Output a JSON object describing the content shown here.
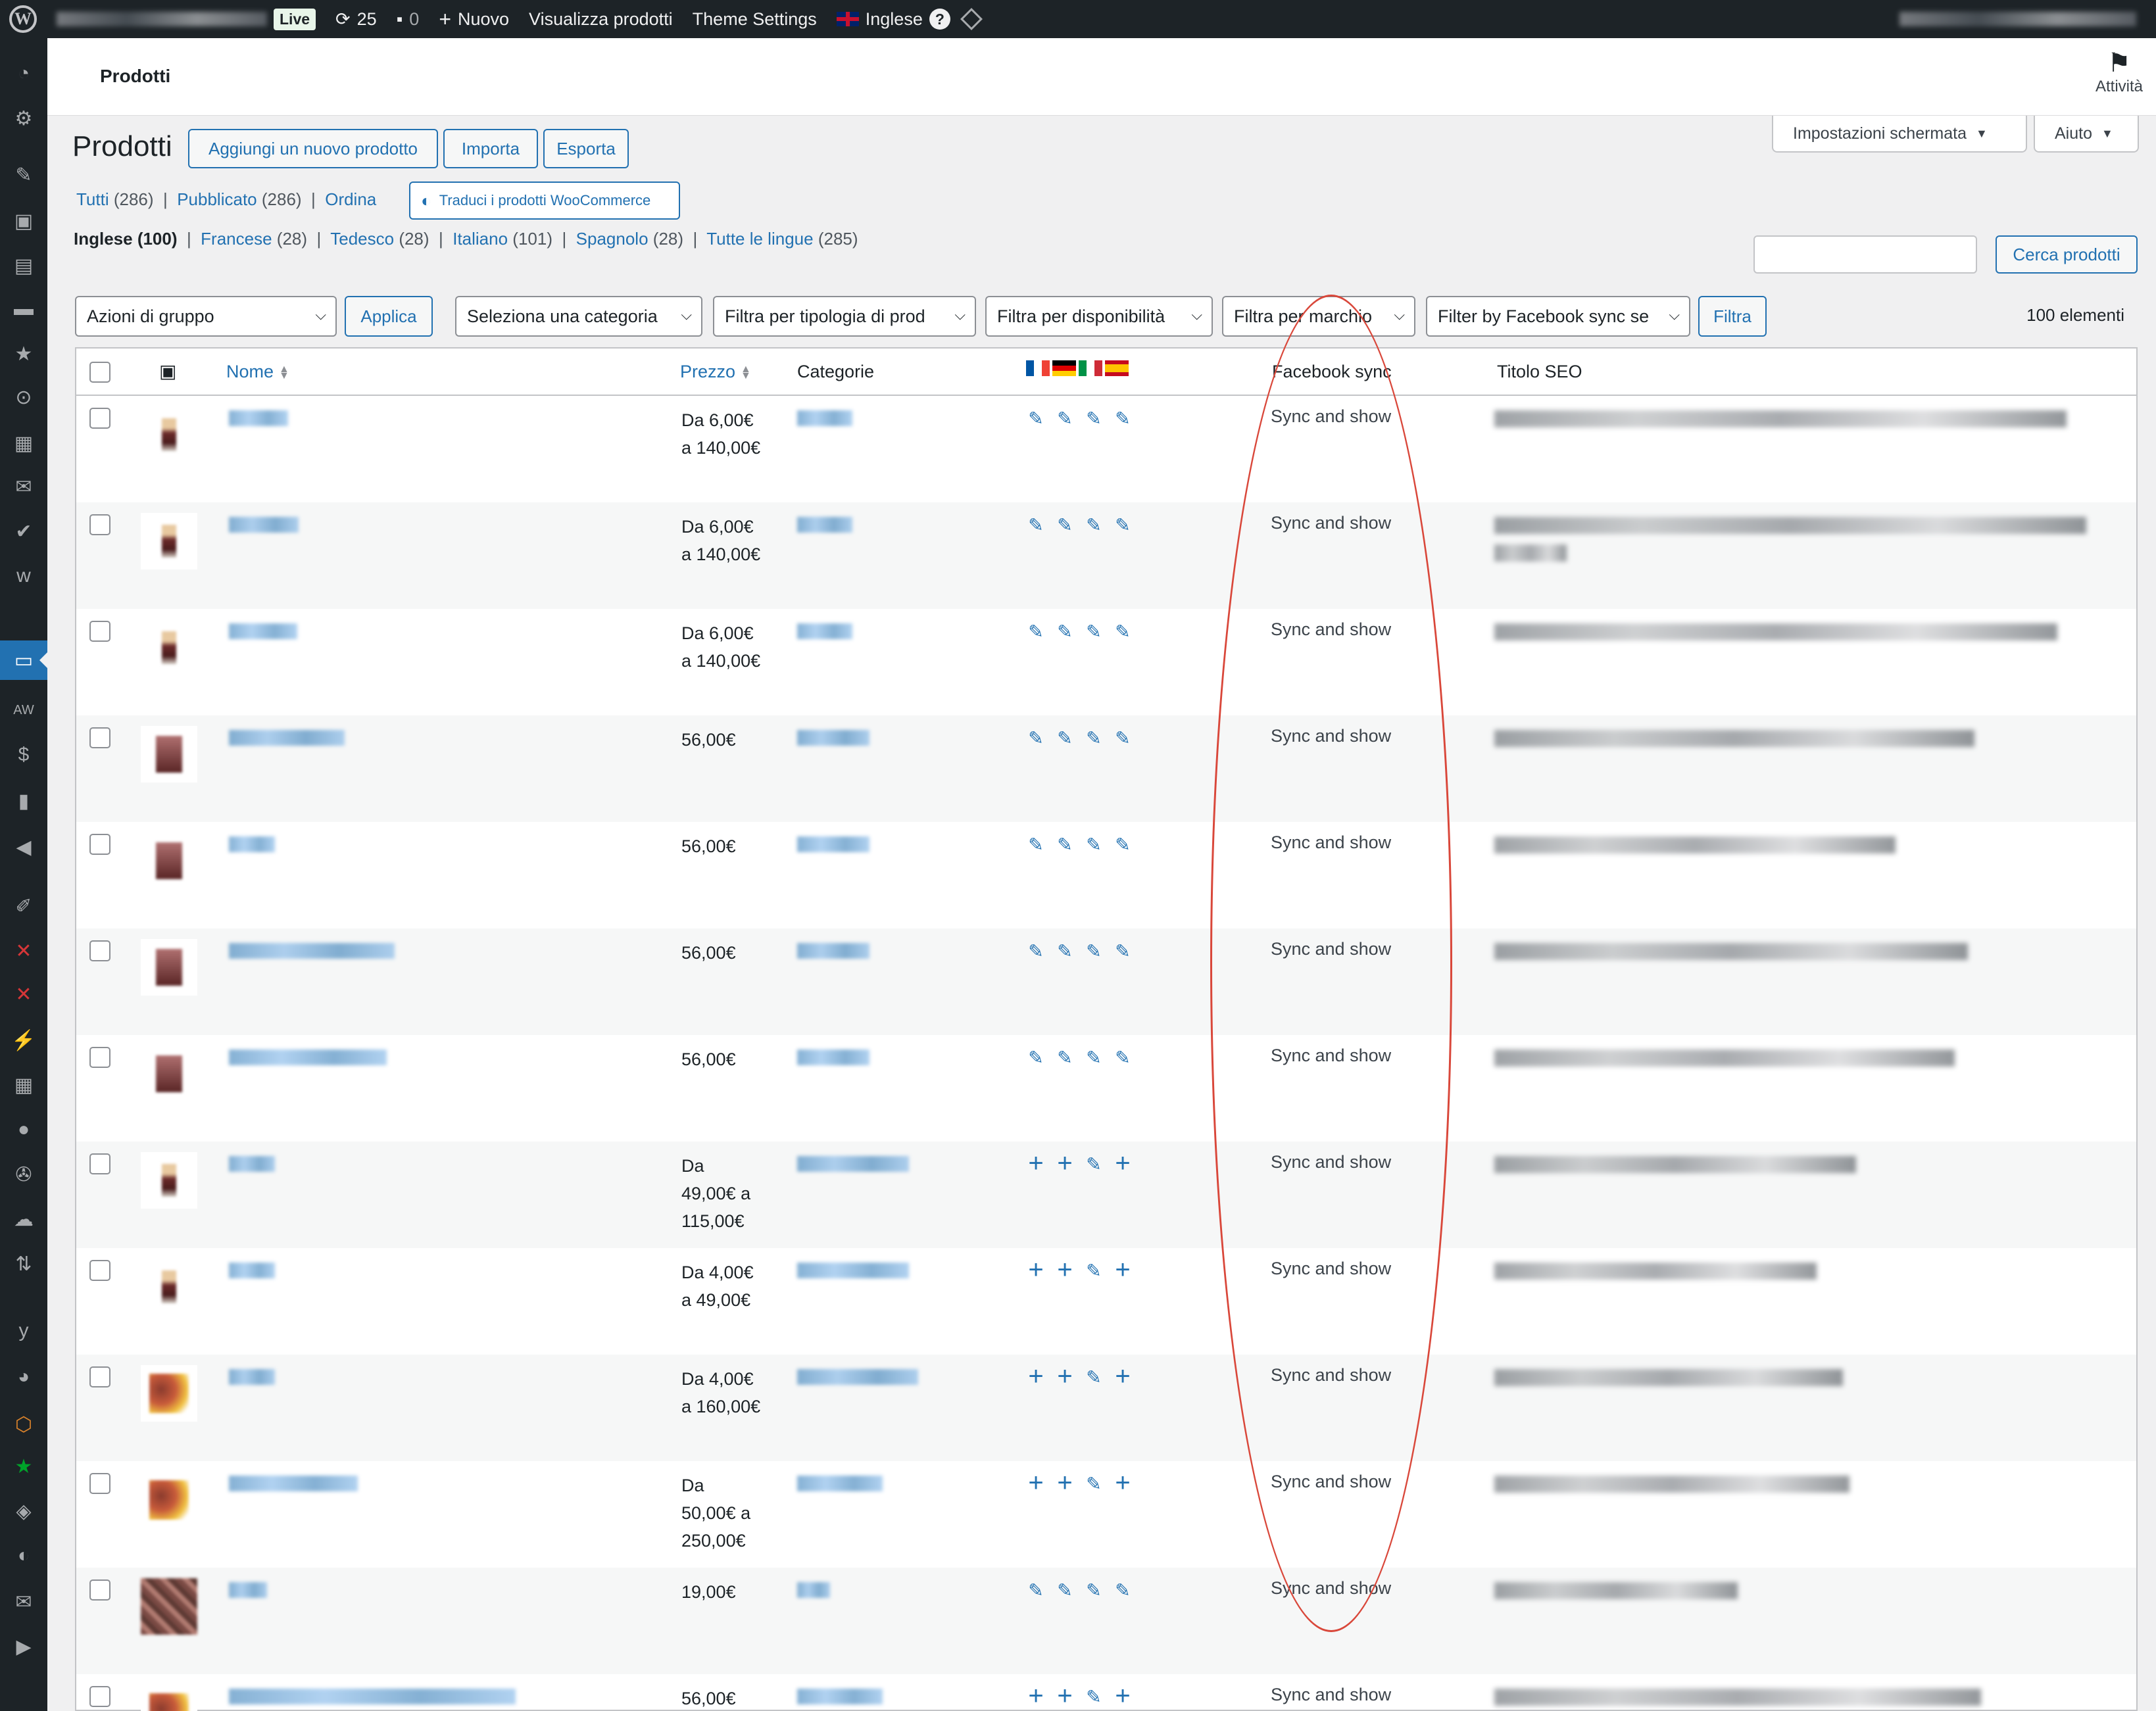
{
  "adminbar": {
    "live": "Live",
    "updates": "25",
    "comments": "0",
    "new": "Nuovo",
    "view_products": "Visualizza prodotti",
    "theme_settings": "Theme Settings",
    "language": "Inglese",
    "help": "?"
  },
  "header": {
    "title": "Prodotti",
    "activity": "Attività"
  },
  "page": {
    "title": "Prodotti",
    "add_new": "Aggiungi un nuovo prodotto",
    "import": "Importa",
    "export": "Esporta",
    "screen_options": "Impostazioni schermata",
    "help": "Aiuto"
  },
  "status_links": {
    "all": "Tutti",
    "all_count": "(286)",
    "published": "Pubblicato",
    "published_count": "(286)",
    "order": "Ordina",
    "translate": "Traduci i prodotti WooCommerce"
  },
  "lang_links": {
    "english": "Inglese (100)",
    "french": "Francese",
    "french_count": "(28)",
    "german": "Tedesco",
    "german_count": "(28)",
    "italian": "Italiano",
    "italian_count": "(101)",
    "spanish": "Spagnolo",
    "spanish_count": "(28)",
    "all": "Tutte le lingue",
    "all_count": "(285)"
  },
  "search": {
    "button": "Cerca prodotti"
  },
  "filters": {
    "bulk": "Azioni di gruppo",
    "apply": "Applica",
    "category": "Seleziona una categoria",
    "type": "Filtra per tipologia di prod",
    "availability": "Filtra per disponibilità",
    "brand": "Filtra per marchio",
    "facebook": "Filter by Facebook sync se",
    "filter": "Filtra",
    "count": "100 elementi"
  },
  "columns": {
    "name": "Nome",
    "price": "Prezzo",
    "categories": "Categorie",
    "facebook": "Facebook sync",
    "seo": "Titolo SEO"
  },
  "rows": [
    {
      "price": [
        "Da 6,00€",
        "a 140,00€"
      ],
      "facebook": "Sync and show",
      "translations": [
        "edit",
        "edit",
        "edit",
        "edit"
      ]
    },
    {
      "price": [
        "Da 6,00€",
        "a 140,00€"
      ],
      "facebook": "Sync and show",
      "translations": [
        "edit",
        "edit",
        "edit",
        "edit"
      ]
    },
    {
      "price": [
        "Da 6,00€",
        "a 140,00€"
      ],
      "facebook": "Sync and show",
      "translations": [
        "edit",
        "edit",
        "edit",
        "edit"
      ]
    },
    {
      "price": [
        "56,00€"
      ],
      "facebook": "Sync and show",
      "translations": [
        "edit",
        "edit",
        "edit",
        "edit"
      ]
    },
    {
      "price": [
        "56,00€"
      ],
      "facebook": "Sync and show",
      "translations": [
        "edit",
        "edit",
        "edit",
        "edit"
      ]
    },
    {
      "price": [
        "56,00€"
      ],
      "facebook": "Sync and show",
      "translations": [
        "edit",
        "edit",
        "edit",
        "edit"
      ]
    },
    {
      "price": [
        "56,00€"
      ],
      "facebook": "Sync and show",
      "translations": [
        "edit",
        "edit",
        "edit",
        "edit"
      ]
    },
    {
      "price": [
        "Da",
        "49,00€ a",
        "115,00€"
      ],
      "facebook": "Sync and show",
      "translations": [
        "add",
        "add",
        "edit",
        "add"
      ]
    },
    {
      "price": [
        "Da 4,00€",
        "a 49,00€"
      ],
      "facebook": "Sync and show",
      "translations": [
        "add",
        "add",
        "edit",
        "add"
      ]
    },
    {
      "price": [
        "Da 4,00€",
        "a 160,00€"
      ],
      "facebook": "Sync and show",
      "translations": [
        "add",
        "add",
        "edit",
        "add"
      ]
    },
    {
      "price": [
        "Da",
        "50,00€ a",
        "250,00€"
      ],
      "facebook": "Sync and show",
      "translations": [
        "add",
        "add",
        "edit",
        "add"
      ]
    },
    {
      "price": [
        "19,00€"
      ],
      "facebook": "Sync and show",
      "translations": [
        "edit",
        "edit",
        "edit",
        "edit"
      ]
    },
    {
      "price": [
        "56,00€"
      ],
      "facebook": "Sync and show",
      "translations": [
        "add",
        "add",
        "edit",
        "add"
      ]
    }
  ],
  "colors": {
    "accent": "#2271b1",
    "adminbar": "#1d2327",
    "annotation": "#d9473a"
  }
}
